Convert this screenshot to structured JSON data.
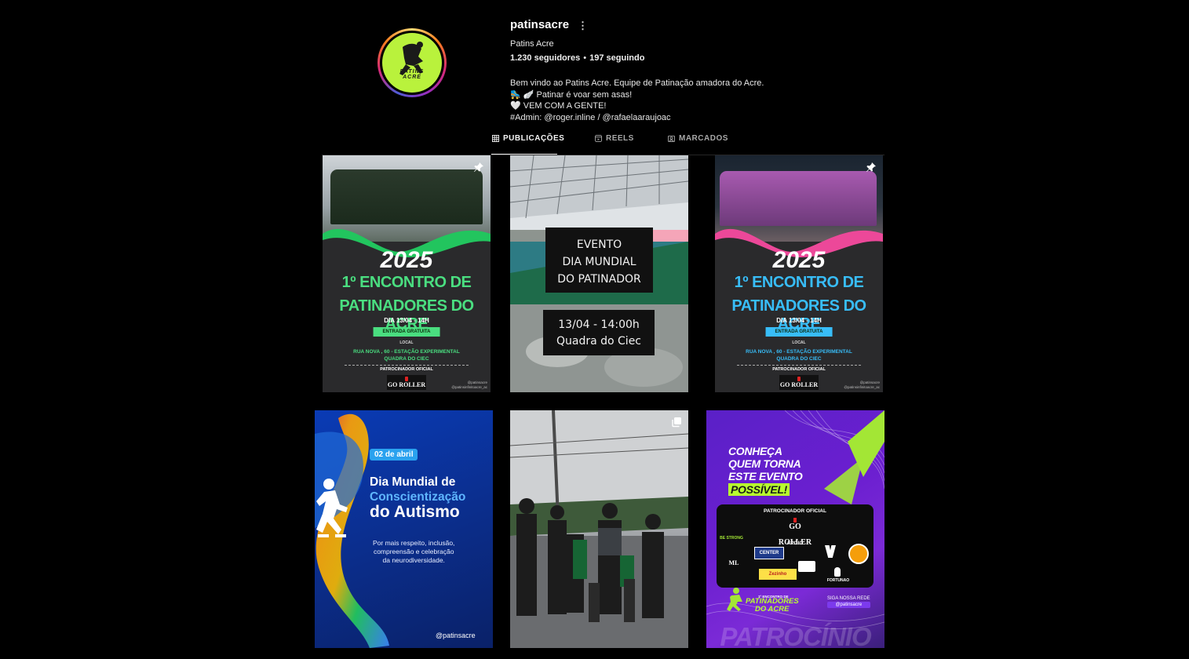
{
  "profile": {
    "username": "patinsacre",
    "more_icon": "ellipsis-vertical-icon",
    "full_name": "Patins Acre",
    "followers": "1.230 seguidores",
    "separator": "•",
    "following": "197 seguindo",
    "avatar_text": "PATINS ACRE",
    "bio": [
      "Bem vindo ao Patins Acre. Equipe de Patinação amadora do Acre.",
      "🛼 🪽 Patinar é voar sem asas!",
      "🤍 VEM COM A GENTE!",
      "#Admin: @roger.inline / @rafaelaaraujoac"
    ]
  },
  "tabs": [
    {
      "label": "PUBLICAÇÕES",
      "icon": "grid-icon",
      "active": true
    },
    {
      "label": "REELS",
      "icon": "reels-icon",
      "active": false
    },
    {
      "label": "MARCADOS",
      "icon": "tagged-icon",
      "active": false
    }
  ],
  "posts": {
    "flyer_green": {
      "year": "2025",
      "line1": "1º ENCONTRO DE",
      "line2": "PATINADORES DO ACRE",
      "date": "DIA 13/04 - 14H",
      "free": "ENTRADA GRATUITA",
      "loc_label": "LOCAL",
      "addr1": "RUA NOVA , 60 - ESTAÇÃO EXPERIMENTAL",
      "addr2": "QUADRA DO CIEC",
      "sponsor": "PATROCINADOR OFICIAL",
      "logo": "GO ROLLER",
      "handle1": "@patinsacre",
      "handle2": "@patinsinfinitoacre_ac",
      "accent": "#22c55e",
      "pinned": true
    },
    "event": {
      "box1_l1": "EVENTO",
      "box1_l2": "DIA MUNDIAL",
      "box1_l3": "DO PATINADOR",
      "box2_l1": "13/04 - 14:00h",
      "box2_l2": "Quadra do Ciec"
    },
    "flyer_pink": {
      "year": "2025",
      "line1": "1º ENCONTRO DE",
      "line2": "PATINADORES DO ACRE",
      "date": "DIA 13/04 - 14H",
      "free": "ENTRADA GRATUITA",
      "loc_label": "LOCAL",
      "addr1": "RUA NOVA , 60 - ESTAÇÃO EXPERIMENTAL",
      "addr2": "QUADRA DO CIEC",
      "sponsor": "PATROCINADOR OFICIAL",
      "logo": "GO ROLLER",
      "handle1": "@patinsacre",
      "handle2": "@patinsinfinitoacre_ac",
      "accent": "#38bdf8",
      "pinned": true
    },
    "autism": {
      "date": "02 de abril",
      "t1": "Dia Mundial de",
      "t2": "Conscientização",
      "t3": "do Autismo",
      "p1": "Por mais respeito, inclusão,",
      "p2": "compreensão e celebração",
      "p3": "da neurodiversidade.",
      "handle": "@patinsacre"
    },
    "group_photo": {
      "multi": true
    },
    "sponsors": {
      "c1": "CONHEÇA",
      "c2": "QUEM TORNA",
      "c3": "ESTE EVENTO",
      "c4": "POSSÍVEL!",
      "title": "PATROCINADOR OFICIAL",
      "logo": "GO ROLLER",
      "apoio": "APOIO",
      "s1": "BE STRONG",
      "s2": "CENTER",
      "s3": "ML",
      "s4": "Zezinho",
      "s5": "FORTUNAO",
      "enc_small": "1º ENCONTRO DE",
      "enc1": "PATINADORES",
      "enc2": "DO ACRE",
      "follow1": "SIGA NOSSA REDE",
      "follow2": "@patinsacre",
      "watermark": "PATROCÍNIO"
    }
  }
}
